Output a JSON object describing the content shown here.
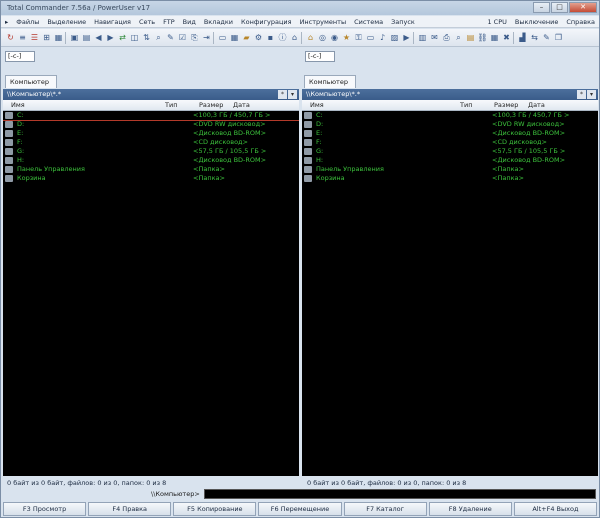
{
  "window": {
    "title": "Total Commander 7.56a / PowerUser v17"
  },
  "menu": {
    "left": [
      "Файлы",
      "Выделение",
      "Навигация",
      "Сеть",
      "FTP",
      "Вид",
      "Вкладки",
      "Конфигурация",
      "Инструменты",
      "Система",
      "Запуск"
    ],
    "right": [
      "1 CPU",
      "Выключение",
      "Справка"
    ]
  },
  "left_panel": {
    "drive": "[-c-]",
    "tab": "Компьютер",
    "path": "\\\\Компьютер\\*.*",
    "headers": {
      "name": "Имя",
      "ext": "Тип",
      "size": "Размер",
      "date": "Дата"
    },
    "rows": [
      {
        "name": "C:",
        "size": "<100,3 ГБ / 450,7 ГБ >",
        "selected": true
      },
      {
        "name": "D:",
        "size": "<DVD RW дисковод>"
      },
      {
        "name": "E:",
        "size": "<Дисковод BD-ROM>"
      },
      {
        "name": "F:",
        "size": "<CD дисковод>"
      },
      {
        "name": "G:",
        "size": "<57,5 ГБ / 105,5 ГБ >"
      },
      {
        "name": "H:",
        "size": "<Дисковод BD-ROM>"
      },
      {
        "name": "Панель Управления",
        "size": "<Папка>"
      },
      {
        "name": "Корзина",
        "size": "<Папка>"
      }
    ],
    "status": "0 байт из 0 байт, файлов: 0 из 0, папок: 0 из 8"
  },
  "right_panel": {
    "drive": "[-c-]",
    "tab": "Компьютер",
    "path": "\\\\Компьютер\\*.*",
    "headers": {
      "name": "Имя",
      "ext": "Тип",
      "size": "Размер",
      "date": "Дата"
    },
    "rows": [
      {
        "name": "C:",
        "size": "<100,3 ГБ / 450,7 ГБ >"
      },
      {
        "name": "D:",
        "size": "<DVD RW дисковод>"
      },
      {
        "name": "E:",
        "size": "<Дисковод BD-ROM>"
      },
      {
        "name": "F:",
        "size": "<CD дисковод>"
      },
      {
        "name": "G:",
        "size": "<57,5 ГБ / 105,5 ГБ >"
      },
      {
        "name": "H:",
        "size": "<Дисковод BD-ROM>"
      },
      {
        "name": "Панель Управления",
        "size": "<Папка>"
      },
      {
        "name": "Корзина",
        "size": "<Папка>"
      }
    ],
    "status": "0 байт из 0 байт, файлов: 0 из 0, папок: 0 из 8"
  },
  "cmdline": {
    "label": "\\\\Компьютер>"
  },
  "fkeys": [
    "F3 Просмотр",
    "F4 Правка",
    "F5 Копирование",
    "F6 Перемещение",
    "F7 Каталог",
    "F8 Удаление",
    "Alt+F4 Выход"
  ],
  "colors": {
    "list_bg": "#000000",
    "list_text": "#3cc23c",
    "path_bar": "#3a5c8a"
  }
}
